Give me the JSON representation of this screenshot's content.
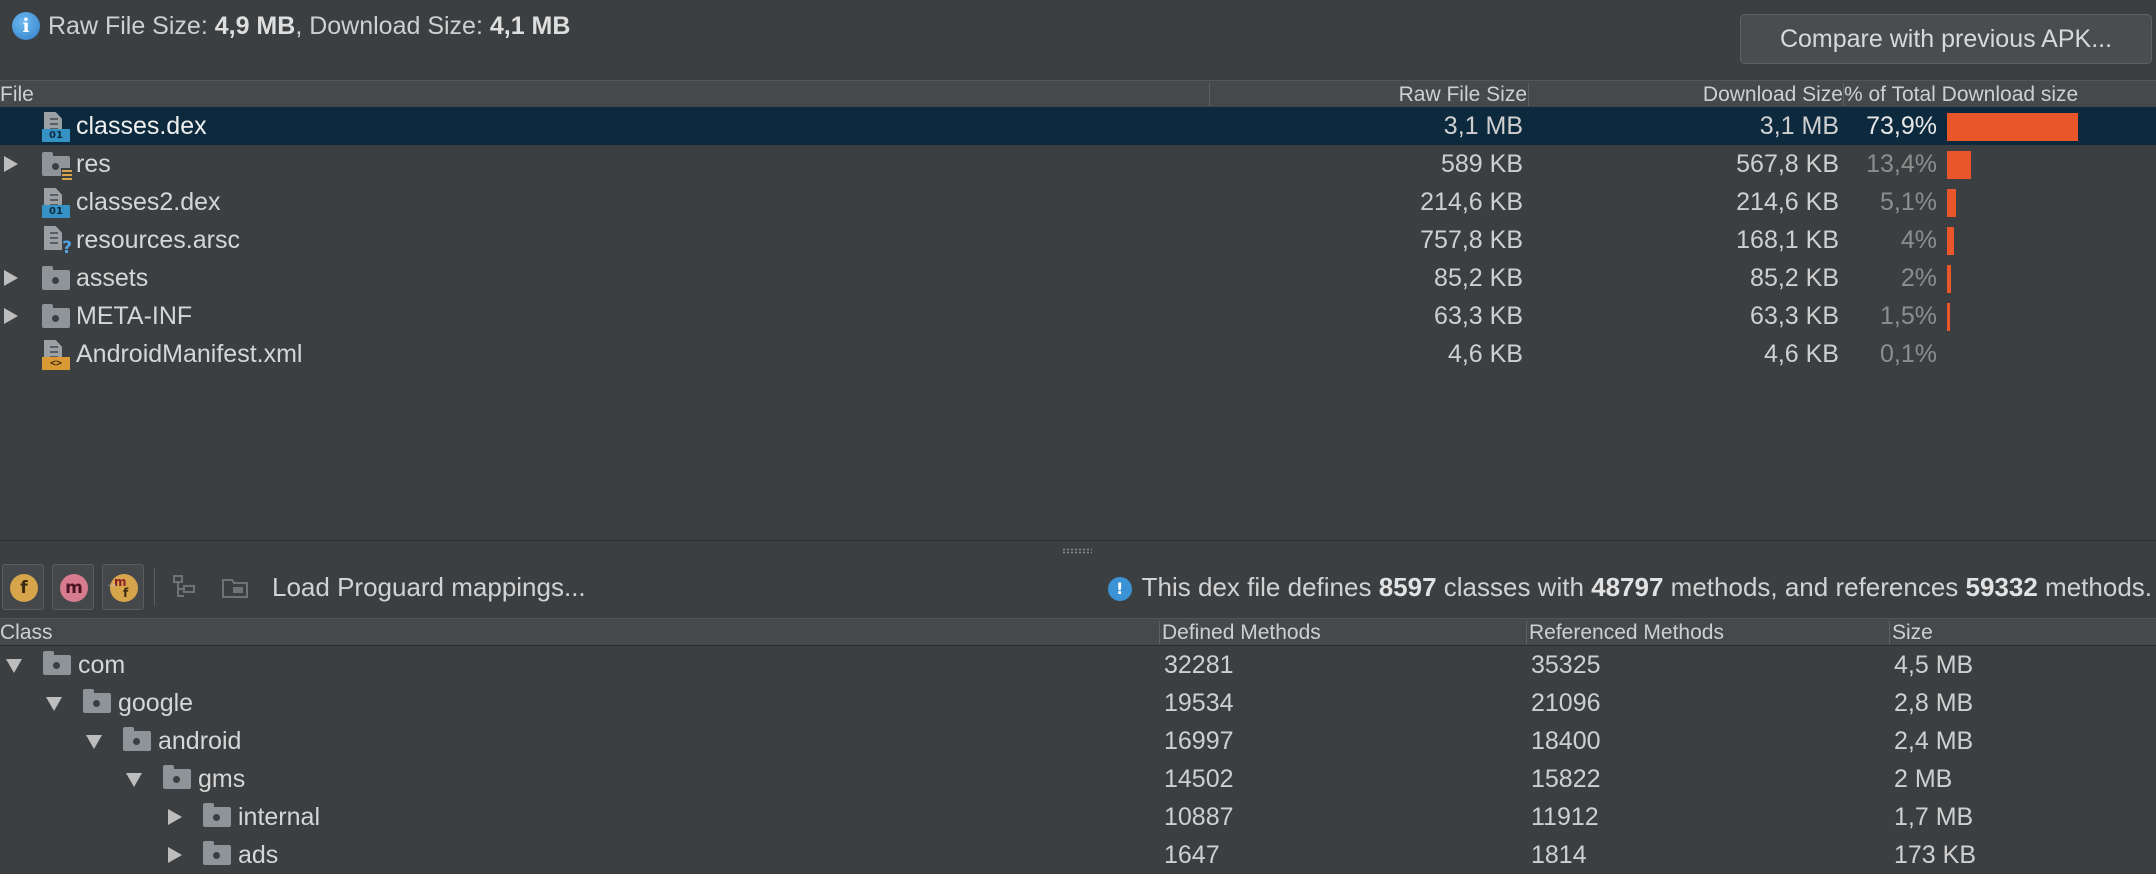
{
  "summary": {
    "raw_label": "Raw File Size: ",
    "raw_value": "4,9 MB",
    "sep": ", Download Size: ",
    "dl_value": "4,1 MB"
  },
  "compare_button": "Compare with previous APK...",
  "file_table": {
    "headers": {
      "file": "File",
      "raw": "Raw File Size",
      "dl": "Download Size",
      "pct": "% of Total Download size"
    },
    "rows": [
      {
        "name": "classes.dex",
        "icon": "dex-file-icon",
        "raw": "3,1 MB",
        "dl": "3,1 MB",
        "pct": "73,9%",
        "share": 73.9,
        "expandable": false,
        "selected": true
      },
      {
        "name": "res",
        "icon": "res-folder-icon",
        "raw": "589 KB",
        "dl": "567,8 KB",
        "pct": "13,4%",
        "share": 13.4,
        "expandable": true,
        "selected": false
      },
      {
        "name": "classes2.dex",
        "icon": "dex-file-icon",
        "raw": "214,6 KB",
        "dl": "214,6 KB",
        "pct": "5,1%",
        "share": 5.1,
        "expandable": false,
        "selected": false
      },
      {
        "name": "resources.arsc",
        "icon": "unknown-file-icon",
        "raw": "757,8 KB",
        "dl": "168,1 KB",
        "pct": "4%",
        "share": 4.0,
        "expandable": false,
        "selected": false
      },
      {
        "name": "assets",
        "icon": "folder-icon",
        "raw": "85,2 KB",
        "dl": "85,2 KB",
        "pct": "2%",
        "share": 2.0,
        "expandable": true,
        "selected": false
      },
      {
        "name": "META-INF",
        "icon": "folder-icon",
        "raw": "63,3 KB",
        "dl": "63,3 KB",
        "pct": "1,5%",
        "share": 1.5,
        "expandable": true,
        "selected": false
      },
      {
        "name": "AndroidManifest.xml",
        "icon": "xml-file-icon",
        "raw": "4,6 KB",
        "dl": "4,6 KB",
        "pct": "0,1%",
        "share": 0.1,
        "expandable": false,
        "selected": false
      }
    ]
  },
  "toolbar": {
    "field_btn": "f",
    "method_btn": "m",
    "ref_btn": "m",
    "ref_sub": "f",
    "load_proguard": "Load Proguard mappings..."
  },
  "dex_info": {
    "p1": "This dex file defines ",
    "classes": "8597",
    "p2": " classes with ",
    "methods": "48797",
    "p3": " methods, and references ",
    "refs": "59332",
    "p4": " methods."
  },
  "class_table": {
    "headers": {
      "class": "Class",
      "defined": "Defined Methods",
      "referenced": "Referenced Methods",
      "size": "Size"
    },
    "rows": [
      {
        "name": "com",
        "depth": 0,
        "expanded": true,
        "defined": "32281",
        "referenced": "35325",
        "size": "4,5 MB"
      },
      {
        "name": "google",
        "depth": 1,
        "expanded": true,
        "defined": "19534",
        "referenced": "21096",
        "size": "2,8 MB"
      },
      {
        "name": "android",
        "depth": 2,
        "expanded": true,
        "defined": "16997",
        "referenced": "18400",
        "size": "2,4 MB"
      },
      {
        "name": "gms",
        "depth": 3,
        "expanded": true,
        "defined": "14502",
        "referenced": "15822",
        "size": "2 MB"
      },
      {
        "name": "internal",
        "depth": 4,
        "expanded": false,
        "defined": "10887",
        "referenced": "11912",
        "size": "1,7 MB"
      },
      {
        "name": "ads",
        "depth": 4,
        "expanded": false,
        "defined": "1647",
        "referenced": "1814",
        "size": "173 KB"
      }
    ]
  },
  "colors": {
    "selection": "#0d293e",
    "bar": "#e8562a",
    "background": "#3c3f41",
    "header": "#46494b"
  }
}
